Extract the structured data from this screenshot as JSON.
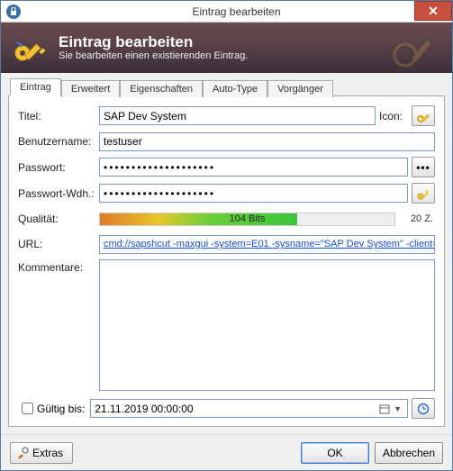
{
  "window": {
    "title": "Eintrag bearbeiten",
    "close_glyph": "✕"
  },
  "header": {
    "title": "Eintrag bearbeiten",
    "subtitle": "Sie bearbeiten einen existierenden Eintrag."
  },
  "tabs": [
    "Eintrag",
    "Erweitert",
    "Eigenschaften",
    "Auto-Type",
    "Vorgänger"
  ],
  "labels": {
    "titel": "Titel:",
    "icon": "Icon:",
    "benutzer": "Benutzername:",
    "passwort": "Passwort:",
    "passwort_wdh": "Passwort-Wdh.:",
    "qualitaet": "Qualität:",
    "url": "URL:",
    "kommentare": "Kommentare:",
    "gueltig": "Gültig bis:",
    "extras": "Extras",
    "ok": "OK",
    "abbrechen": "Abbrechen"
  },
  "values": {
    "titel": "SAP Dev System",
    "benutzer": "testuser",
    "passwort_mask": "••••••••••••••••••••",
    "passwort_wdh_mask": "••••••••••••••••••••",
    "quality_text": "104 Bits",
    "quality_chars": "20 Z.",
    "url": "cmd://sapshcut -maxgui -system=E01 -sysname=\"SAP Dev System\" -client=",
    "expiry": "21.11.2019 00:00:00"
  },
  "colors": {
    "key_yellow": "#f4c430",
    "close_red": "#c94f3e"
  }
}
